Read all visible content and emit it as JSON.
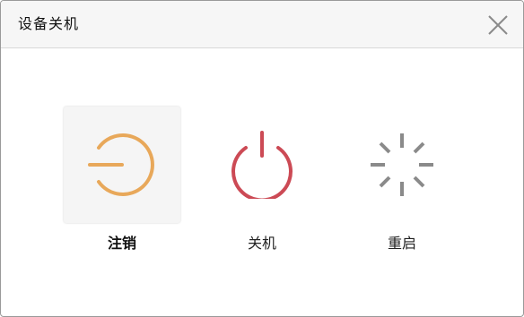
{
  "dialog": {
    "title": "设备关机"
  },
  "actions": [
    {
      "label": "注销",
      "icon": "logout-icon",
      "color": "#e8a85a",
      "selected": true
    },
    {
      "label": "关机",
      "icon": "power-icon",
      "color": "#cc4a55",
      "selected": false
    },
    {
      "label": "重启",
      "icon": "restart-spinner-icon",
      "color": "#8a8a8a",
      "selected": false
    }
  ]
}
